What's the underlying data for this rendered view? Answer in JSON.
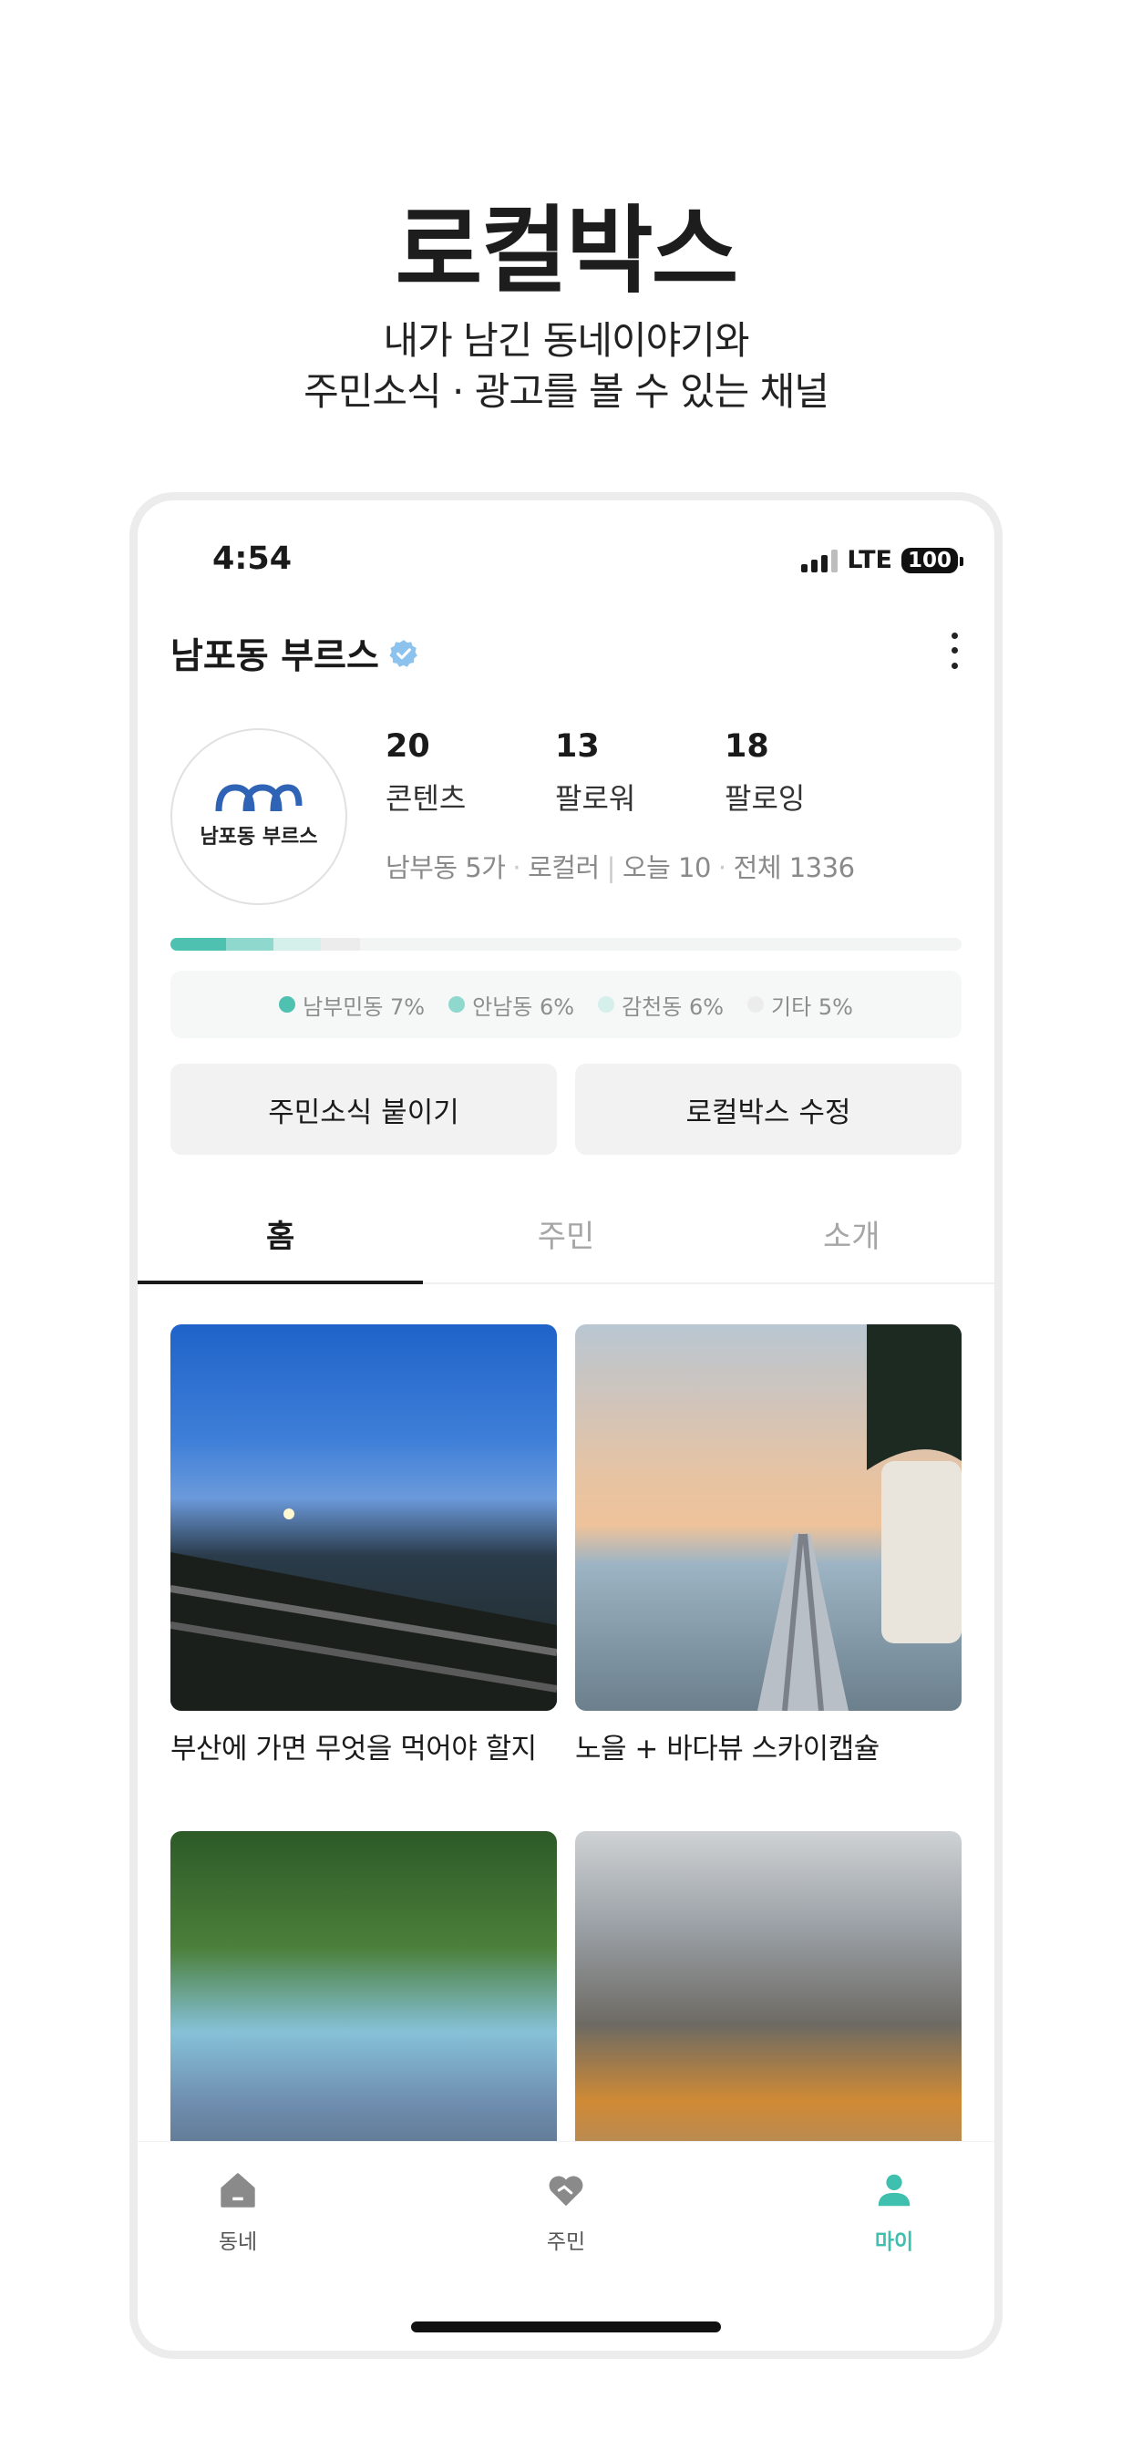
{
  "hero": {
    "title": "로컬박스",
    "subtitle_line1": "내가 남긴 동네이야기와",
    "subtitle_line2": "주민소식 · 광고를 볼 수 있는 채널"
  },
  "status_bar": {
    "time": "4:54",
    "network": "LTE",
    "battery": "100"
  },
  "profile": {
    "name": "남포동 부르스",
    "avatar_text": "남포동 부르스",
    "stats": [
      {
        "value": "20",
        "label": "콘텐츠"
      },
      {
        "value": "13",
        "label": "팔로워"
      },
      {
        "value": "18",
        "label": "팔로잉"
      }
    ],
    "meta": {
      "location": "남부동 5가",
      "role": "로컬러",
      "today": "오늘 10",
      "total": "전체 1336"
    }
  },
  "distribution": {
    "items": [
      {
        "label": "남부민동 7%",
        "color": "#4fc1b1",
        "share": 0.07
      },
      {
        "label": "안남동 6%",
        "color": "#8fd8ce",
        "share": 0.06
      },
      {
        "label": "감천동 6%",
        "color": "#d5efeb",
        "share": 0.06
      },
      {
        "label": "기타 5%",
        "color": "#ececec",
        "share": 0.05
      }
    ]
  },
  "actions": {
    "post_news": "주민소식 붙이기",
    "edit_box": "로컬박스 수정"
  },
  "tabs": [
    {
      "label": "홈",
      "active": true
    },
    {
      "label": "주민",
      "active": false
    },
    {
      "label": "소개",
      "active": false
    }
  ],
  "posts": [
    {
      "caption": "부산에 가면 무엇을 먹어야 할지"
    },
    {
      "caption": "노을 + 바다뷰 스카이캡슐"
    },
    {
      "caption": ""
    },
    {
      "caption": ""
    }
  ],
  "bottom_nav": [
    {
      "label": "동네",
      "icon": "home-icon",
      "active": false
    },
    {
      "label": "주민",
      "icon": "heart-handshake-icon",
      "active": false
    },
    {
      "label": "마이",
      "icon": "person-icon",
      "active": true
    }
  ],
  "colors": {
    "accent": "#3fbfad"
  }
}
